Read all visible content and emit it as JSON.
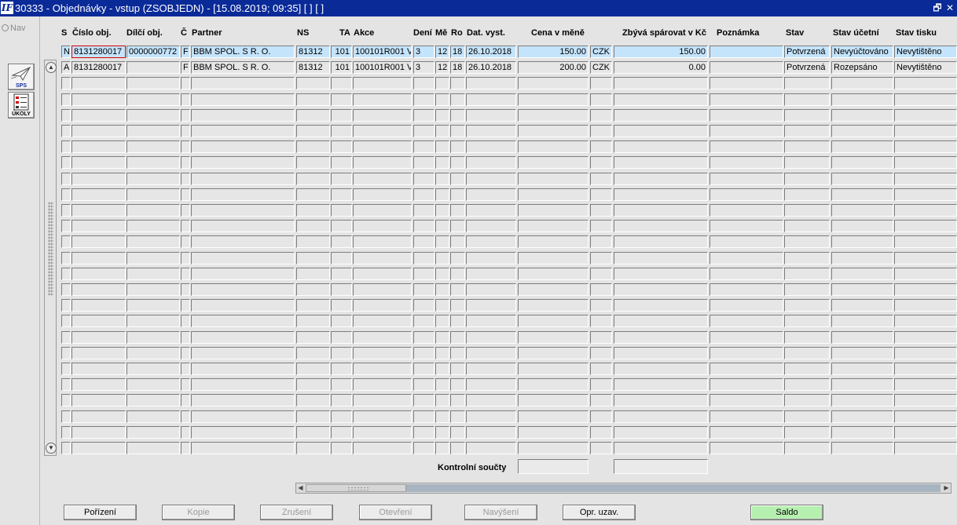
{
  "window": {
    "logo": "IF",
    "title": "30333 - Objednávky - vstup (ZSOBJEDN) - [15.08.2019; 09:35]  [ ]  [ ]",
    "restore_glyph": "🗗",
    "close_glyph": "✕"
  },
  "left_pane": {
    "nav_label": "Nav",
    "tools": [
      {
        "name": "sps-tool",
        "label": "SPS",
        "icon": "paper-plane-icon"
      },
      {
        "name": "ukoly-tool",
        "label": "ÚKOLY",
        "icon": "task-list-icon"
      }
    ]
  },
  "grid": {
    "columns": [
      "S",
      "Číslo obj.",
      "Dílčí obj.",
      "Č",
      "Partner",
      "NS",
      "TA",
      "Akce",
      "Dení",
      "Mě",
      "Ro",
      "Dat. vyst.",
      "Cena v měně",
      "",
      "Zbývá spárovat v Kč",
      "Poznámka",
      "Stav",
      "Stav účetní",
      "Stav tisku"
    ],
    "rows": [
      [
        "N",
        "8131280017",
        "0000000772",
        "F",
        "BBM SPOL. S R. O.",
        "81312",
        "101",
        "100101R001 V",
        "3",
        "12",
        "18",
        "26.10.2018",
        "150.00",
        "CZK",
        "150.00",
        "",
        "Potvrzená",
        "Nevyúčtováno",
        "Nevytištěno"
      ],
      [
        "A",
        "8131280017",
        "",
        "F",
        "BBM SPOL. S R. O.",
        "81312",
        "101",
        "100101R001 V",
        "3",
        "12",
        "18",
        "26.10.2018",
        "200.00",
        "CZK",
        "0.00",
        "",
        "Potvrzená",
        "Rozepsáno",
        "Nevytištěno"
      ]
    ],
    "scroll_up": "▲",
    "scroll_down": "▼"
  },
  "totals": {
    "label": "Kontrolní součty",
    "sum1": "",
    "sum2": ""
  },
  "hscroll": {
    "left": "◀",
    "right": "▶"
  },
  "buttons": [
    {
      "name": "porizeni-button",
      "label": "Pořízení",
      "state": "enabled"
    },
    {
      "name": "kopie-button",
      "label": "Kopie",
      "state": "disabled"
    },
    {
      "name": "zruseni-button",
      "label": "Zrušení",
      "state": "disabled"
    },
    {
      "name": "otevreni-button",
      "label": "Otevření",
      "state": "disabled"
    },
    {
      "name": "navyseni-button",
      "label": "Navýšení",
      "state": "disabled"
    },
    {
      "name": "opr-uzav-button",
      "label": "Opr. uzav.",
      "state": "enabled"
    },
    {
      "name": "saldo-button",
      "label": "Saldo",
      "state": "highlighted"
    }
  ],
  "colors": {
    "titlebar": "#0a2a98",
    "selected_row": "#c4e4fc",
    "focus_border": "#d80000",
    "saldo_button": "#b6f0b0"
  }
}
